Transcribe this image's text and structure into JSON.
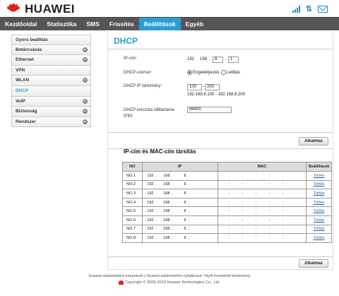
{
  "brand": {
    "name": "HUAWEI",
    "color": "#e0201c"
  },
  "status_icons": [
    "signal-icon",
    "data-transfer-icon",
    "sms-icon"
  ],
  "nav": {
    "items": [
      "Kezdőoldal",
      "Statisztika",
      "SMS",
      "Frissítés",
      "Beállítások",
      "Egyéb"
    ],
    "active": "Beállítások",
    "active_color": "#2a9fd6"
  },
  "sidebar": {
    "items": [
      {
        "label": "Gyors beállítás",
        "arrow": false
      },
      {
        "label": "Betárcsázás",
        "arrow": true
      },
      {
        "label": "Ethernet",
        "arrow": true
      },
      {
        "label": "VPN",
        "arrow": false
      },
      {
        "label": "WLAN",
        "arrow": true
      },
      {
        "label": "DHCP",
        "arrow": false
      },
      {
        "label": "VoIP",
        "arrow": true
      },
      {
        "label": "Biztonság",
        "arrow": true
      },
      {
        "label": "Rendszer",
        "arrow": true
      }
    ],
    "active": "DHCP"
  },
  "page": {
    "title": "DHCP",
    "ip_label": "IP-cím:",
    "ip": [
      "192",
      "158",
      "8",
      "1"
    ],
    "dhcp_server_label": "DHCP-szerver:",
    "enable_label": "Engedélyezés",
    "disable_label": "Letiltás",
    "dhcp_range_label": "DHCP IP tartomány:",
    "range_start": "100",
    "range_end": "200",
    "range_hint": "192.168.8.100 - 192.168.8.200",
    "lease_label": "DHCP kiosztási időtartama (mp):",
    "lease_value": "86400",
    "apply_label": "Alkalmaz"
  },
  "binding": {
    "title": "IP-cím és MAC-cím társítás",
    "columns": [
      "NO",
      "IP",
      "MAC",
      "Beállítások"
    ],
    "rows": [
      {
        "no": "NO.1",
        "ip": [
          "192",
          "168",
          "8",
          ""
        ],
        "action": "Törlés"
      },
      {
        "no": "NO.2",
        "ip": [
          "192",
          "168",
          "8",
          ""
        ],
        "action": "Törlés"
      },
      {
        "no": "NO.3",
        "ip": [
          "192",
          "168",
          "8",
          ""
        ],
        "action": "Törlés"
      },
      {
        "no": "NO.4",
        "ip": [
          "192",
          "168",
          "8",
          ""
        ],
        "action": "Törlés"
      },
      {
        "no": "NO.5",
        "ip": [
          "192",
          "168",
          "8",
          ""
        ],
        "action": "Törlés"
      },
      {
        "no": "NO.6",
        "ip": [
          "192",
          "168",
          "8",
          ""
        ],
        "action": "Törlés"
      },
      {
        "no": "NO.7",
        "ip": [
          "192",
          "168",
          "8",
          ""
        ],
        "action": "Törlés"
      },
      {
        "no": "NO.8",
        "ip": [
          "192",
          "168",
          "8",
          ""
        ],
        "action": "Törlés"
      }
    ],
    "apply_label": "Alkalmaz"
  },
  "footer": {
    "links": "Huawei adatvédelmi irányelvek | Huawei adatvédelmi nyilatkozat | Nyílt forráskód közlemény",
    "copyright": "Copyright © 2006-2019 Huawei Technologies Co., Ltd."
  }
}
